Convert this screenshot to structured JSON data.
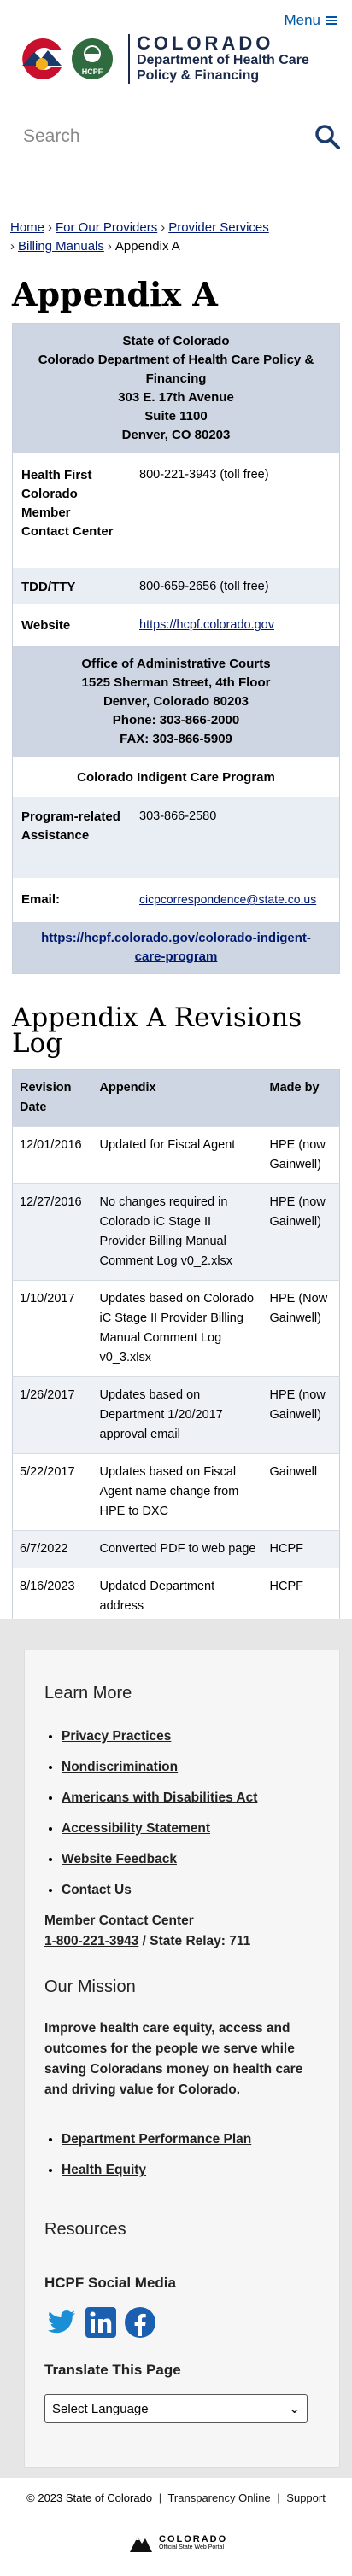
{
  "header": {
    "menu_label": "Menu",
    "logo_title": "COLORADO",
    "logo_subtitle_1": "Department of Health Care",
    "logo_subtitle_2": "Policy & Financing",
    "logo_badge": "HCPF"
  },
  "search": {
    "placeholder": "Search"
  },
  "breadcrumb": [
    "Home",
    "For Our Providers",
    "Provider Services",
    "Billing Manuals",
    "Appendix A"
  ],
  "page_title": "Appendix A",
  "info": {
    "address_block": [
      "State of Colorado",
      "Colorado Department of Health Care Policy & Financing",
      "303 E. 17th Avenue",
      "Suite 1100",
      "Denver, CO 80203"
    ],
    "rows1": [
      {
        "label": "Health First Colorado Member Contact Center",
        "value": "800-221-3943 (toll free)",
        "link": false
      },
      {
        "label": "TDD/TTY",
        "value": "800-659-2656 (toll free)",
        "link": false
      },
      {
        "label": "Website",
        "value": "https://hcpf.colorado.gov",
        "link": true
      }
    ],
    "courts_block": [
      "Office of Administrative Courts",
      "1525 Sherman Street, 4th Floor",
      "Denver, Colorado 80203",
      "Phone: 303-866-2000",
      "FAX: 303-866-5909"
    ],
    "program_title": "Colorado Indigent Care Program",
    "rows2": [
      {
        "label": "Program-related Assistance",
        "value": "303-866-2580",
        "link": false
      },
      {
        "label": "Email:",
        "value": "cicpcorrespondence@state.co.us",
        "link": true
      }
    ],
    "program_link": "https://hcpf.colorado.gov/colorado-indigent-care-program"
  },
  "revisions": {
    "title": "Appendix A Revisions Log",
    "headers": [
      "Revision Date",
      "Appendix",
      "Made by"
    ],
    "rows": [
      [
        "12/01/2016",
        "Updated for Fiscal Agent",
        "HPE (now Gainwell)"
      ],
      [
        "12/27/2016",
        "No changes required in Colorado iC Stage II Provider Billing Manual Comment Log v0_2.xlsx",
        "HPE (now Gainwell)"
      ],
      [
        "1/10/2017",
        "Updates based on Colorado iC Stage II Provider Billing Manual Comment Log v0_3.xlsx",
        "HPE (Now Gainwell)"
      ],
      [
        "1/26/2017",
        "Updates based on Department 1/20/2017 approval email",
        "HPE (now Gainwell)"
      ],
      [
        "5/22/2017",
        "Updates based on Fiscal Agent name change from HPE to DXC",
        "Gainwell"
      ],
      [
        "6/7/2022",
        "Converted PDF to web page",
        "HCPF"
      ],
      [
        "8/16/2023",
        "Updated Department address",
        "HCPF"
      ]
    ]
  },
  "footer": {
    "learn_more_title": "Learn More",
    "learn_links": [
      "Privacy Practices",
      "Nondiscrimination",
      "Americans with Disabilities Act",
      "Accessibility Statement",
      "Website Feedback",
      "Contact Us"
    ],
    "contact_label": "Member Contact Center",
    "contact_phone": "1-800-221-3943",
    "contact_relay": " / State Relay: 711",
    "mission_title": "Our Mission",
    "mission_text": "Improve health care equity, access and outcomes for the people we serve while saving Coloradans money on health care and driving value for Colorado.",
    "mission_links": [
      "Department Performance Plan",
      "Health Equity"
    ],
    "resources_title": "Resources",
    "social_title": "HCPF Social Media",
    "translate_title": "Translate This Page",
    "language_select": "Select Language",
    "copyright": "© 2023 State of Colorado",
    "transparency": "Transparency Online",
    "support": "Support",
    "state_logo_title": "COLORADO",
    "state_logo_sub": "Official State Web Portal"
  },
  "colors": {
    "link": "#001970",
    "accent": "#0055a5",
    "table_dark": "#cdd6e2",
    "table_light": "#e9eef5"
  }
}
